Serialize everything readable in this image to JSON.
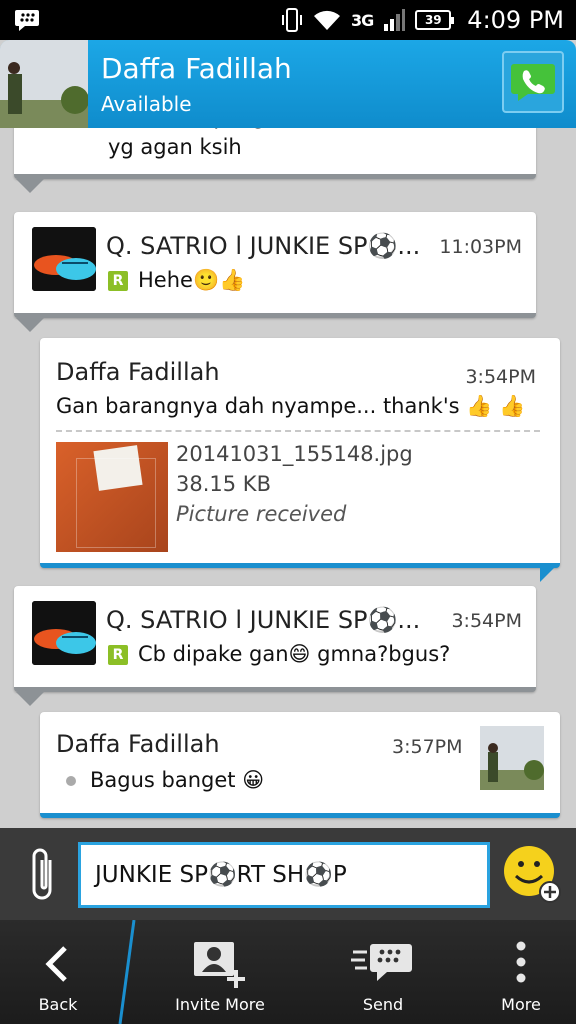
{
  "status_bar": {
    "network": "3G",
    "battery": "39",
    "time": "4:09 PM",
    "icons": [
      "bbm-icon",
      "vibrate-icon",
      "wifi-icon",
      "signal-icon",
      "battery-icon"
    ]
  },
  "header": {
    "contact_name": "Daffa Fadillah",
    "status": "Available",
    "accent": "#1a9ad9"
  },
  "messages": [
    {
      "text": "Psti smpai gan..alamat sesuai sm yg agan ksih",
      "badge": "R"
    },
    {
      "sender": "Q. SATRIO l JUNKIE SP⚽...",
      "time": "11:03PM",
      "text": "Hehe🙂👍",
      "badge": "R"
    },
    {
      "sender": "Daffa Fadillah",
      "time": "3:54PM",
      "text": "Gan barangnya dah nyampe... thank's 👍 👍",
      "attachment": {
        "filename": "20141031_155148.jpg",
        "size": "38.15 KB",
        "status": "Picture received"
      }
    },
    {
      "sender": "Q. SATRIO l JUNKIE SP⚽...",
      "time": "3:54PM",
      "text": "Cb dipake gan😄 gmna?bgus?",
      "badge": "R"
    },
    {
      "sender": "Daffa Fadillah",
      "time": "3:57PM",
      "text": "Bagus banget 😀"
    }
  ],
  "composer": {
    "value": "JUNKIE SP⚽RT SH⚽P"
  },
  "action_bar": {
    "back": "Back",
    "invite_more": "Invite More",
    "send": "Send",
    "more": "More"
  }
}
